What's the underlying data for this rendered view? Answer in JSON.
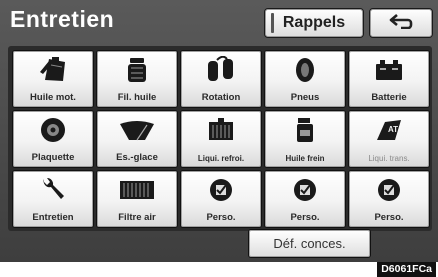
{
  "header": {
    "title": "Entretien",
    "rappels_label": "Rappels",
    "back_icon": "return-arrow-icon"
  },
  "grid": {
    "rows": [
      [
        {
          "label": "Huile mot.",
          "icon": "oil-can-icon"
        },
        {
          "label": "Fil. huile",
          "icon": "oil-filter-icon"
        },
        {
          "label": "Rotation",
          "icon": "tire-rotation-icon"
        },
        {
          "label": "Pneus",
          "icon": "tire-icon"
        },
        {
          "label": "Batterie",
          "icon": "battery-icon"
        }
      ],
      [
        {
          "label": "Plaquette",
          "icon": "brake-pad-icon"
        },
        {
          "label": "Es.-glace",
          "icon": "wiper-icon"
        },
        {
          "label": "Liqui. refroi.",
          "icon": "coolant-radiator-icon"
        },
        {
          "label": "Huile frein",
          "icon": "brake-fluid-icon"
        },
        {
          "label": "Liqui. trans.",
          "icon": "transmission-fluid-icon"
        }
      ],
      [
        {
          "label": "Entretien",
          "icon": "wrench-icon"
        },
        {
          "label": "Filtre air",
          "icon": "air-filter-icon"
        },
        {
          "label": "Perso.",
          "icon": "custom-checkmark-icon"
        },
        {
          "label": "Perso.",
          "icon": "custom-checkmark-icon"
        },
        {
          "label": "Perso.",
          "icon": "custom-checkmark-icon"
        }
      ]
    ]
  },
  "footer": {
    "dealer_label": "Déf. conces.",
    "image_code": "D6061FCa"
  }
}
